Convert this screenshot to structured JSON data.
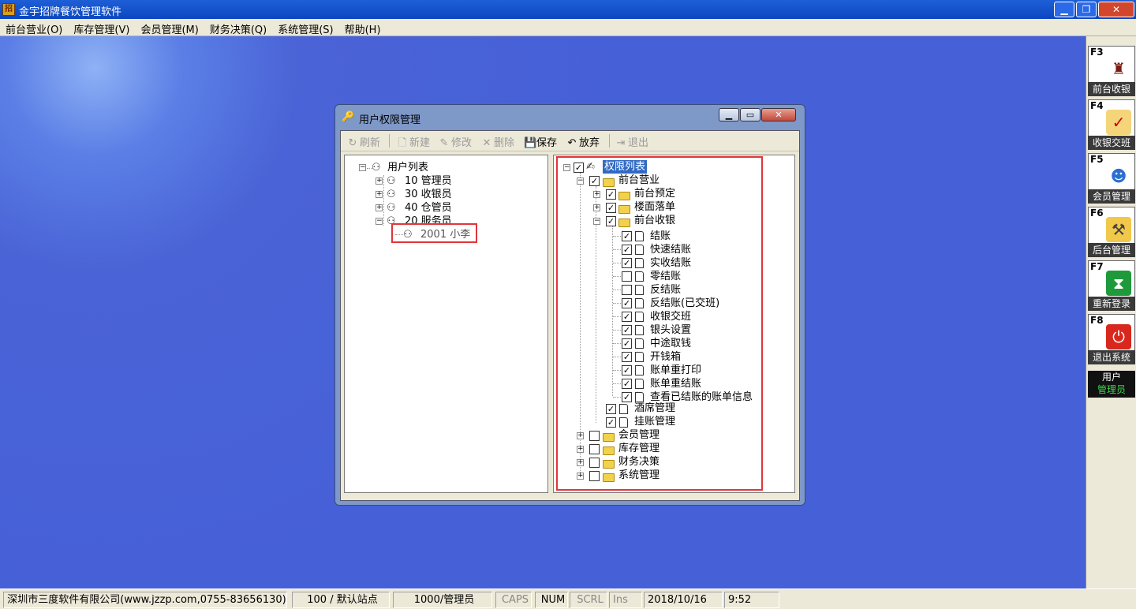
{
  "app": {
    "title": "金宇招牌餐饮管理软件",
    "window_buttons": [
      "▁",
      "❐",
      "✕"
    ]
  },
  "menu": [
    "前台营业(O)",
    "库存管理(V)",
    "会员管理(M)",
    "财务决策(Q)",
    "系统管理(S)",
    "帮助(H)"
  ],
  "rightbar": [
    {
      "key": "F3",
      "label": "前台收银",
      "icon": "dining-table-icon"
    },
    {
      "key": "F4",
      "label": "收银交班",
      "icon": "clipboard-check-icon"
    },
    {
      "key": "F5",
      "label": "会员管理",
      "icon": "members-icon"
    },
    {
      "key": "F6",
      "label": "后台管理",
      "icon": "tools-folder-icon"
    },
    {
      "key": "F7",
      "label": "重新登录",
      "icon": "hourglass-icon"
    },
    {
      "key": "F8",
      "label": "退出系统",
      "icon": "power-icon"
    }
  ],
  "user_box": {
    "label": "用户",
    "value": "管理员"
  },
  "dialog": {
    "title": "用户权限管理",
    "toolbar": {
      "refresh": "刷新",
      "new": "新建",
      "edit": "修改",
      "delete": "删除",
      "save": "保存",
      "discard": "放弃",
      "exit": "退出"
    },
    "user_tree": {
      "root": "用户列表",
      "groups": [
        {
          "label": "10 管理员",
          "expanded": false
        },
        {
          "label": "30 收银员",
          "expanded": false
        },
        {
          "label": "40 仓管员",
          "expanded": false
        },
        {
          "label": "20 服务员",
          "expanded": true
        }
      ],
      "selected_user": "2001 小李"
    },
    "perm_tree": {
      "root": "权限列表",
      "front_desk": "前台营业",
      "front_children": [
        {
          "label": "前台预定",
          "checked": true
        },
        {
          "label": "楼面落单",
          "checked": true
        },
        {
          "label": "前台收银",
          "checked": true
        }
      ],
      "cashier_items": [
        {
          "label": "结账",
          "checked": true
        },
        {
          "label": "快速结账",
          "checked": true
        },
        {
          "label": "实收结账",
          "checked": true
        },
        {
          "label": "零结账",
          "checked": false
        },
        {
          "label": "反结账",
          "checked": false
        },
        {
          "label": "反结账(已交班)",
          "checked": true
        },
        {
          "label": "收银交班",
          "checked": true
        },
        {
          "label": "银头设置",
          "checked": true
        },
        {
          "label": "中途取钱",
          "checked": true
        },
        {
          "label": "开钱箱",
          "checked": true
        },
        {
          "label": "账单重打印",
          "checked": true
        },
        {
          "label": "账单重结账",
          "checked": true
        },
        {
          "label": "查看已结账的账单信息",
          "checked": true
        }
      ],
      "front_tail": [
        {
          "label": "酒席管理",
          "checked": true
        },
        {
          "label": "挂账管理",
          "checked": true
        }
      ],
      "top_groups": [
        {
          "label": "会员管理",
          "checked": false
        },
        {
          "label": "库存管理",
          "checked": false
        },
        {
          "label": "财务决策",
          "checked": false
        },
        {
          "label": "系统管理",
          "checked": false
        }
      ]
    }
  },
  "statusbar": {
    "company": "深圳市三度软件有限公司(www.jzzp.com,0755-83656130)",
    "station": "100 / 默认站点",
    "operator": "1000/管理员",
    "caps": "CAPS",
    "num": "NUM",
    "scrl": "SCRL",
    "ins": "Ins",
    "date": "2018/10/16",
    "time": "9:52"
  }
}
